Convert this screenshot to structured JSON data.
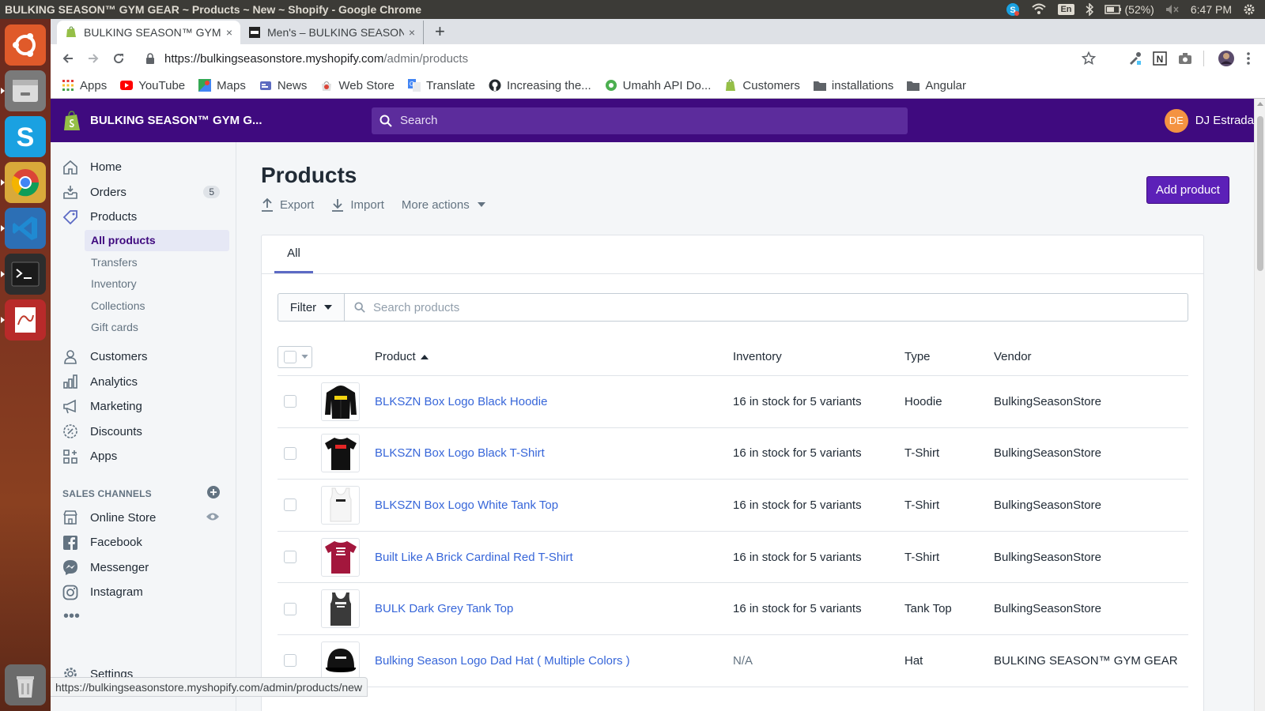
{
  "system": {
    "window_title": "BULKING SEASON™ GYM GEAR ~ Products ~ New ~ Shopify - Google Chrome",
    "lang": "En",
    "battery": "(52%)",
    "time": "6:47 PM"
  },
  "browser": {
    "tabs": [
      {
        "label": "BULKING SEASON™ GYM GEAR ~ Products",
        "close": "×"
      },
      {
        "label": "Men's – BULKING SEASON™ GYM GEAR",
        "close": "×"
      }
    ],
    "new_tab": "+",
    "url_host": "https://bulkingseasonstore.myshopify.com",
    "url_path": "/admin/products",
    "bookmarks": [
      "Apps",
      "YouTube",
      "Maps",
      "News",
      "Web Store",
      "Translate",
      "Increasing the...",
      "Umahh API Do...",
      "Customers",
      "installations",
      "Angular"
    ],
    "status_url": "https://bulkingseasonstore.myshopify.com/admin/products/new"
  },
  "shopify": {
    "store_name": "BULKING SEASON™ GYM G...",
    "search_placeholder": "Search",
    "user_initials": "DE",
    "user_name": "DJ Estrada",
    "nav": {
      "home": "Home",
      "orders": "Orders",
      "orders_badge": "5",
      "products": "Products",
      "sub": [
        "All products",
        "Transfers",
        "Inventory",
        "Collections",
        "Gift cards"
      ],
      "customers": "Customers",
      "analytics": "Analytics",
      "marketing": "Marketing",
      "discounts": "Discounts",
      "apps": "Apps",
      "sales_channels": "SALES CHANNELS",
      "channels": [
        "Online Store",
        "Facebook",
        "Messenger",
        "Instagram"
      ],
      "more": "•••",
      "settings": "Settings"
    },
    "page": {
      "title": "Products",
      "export": "Export",
      "import": "Import",
      "more_actions": "More actions",
      "add_product": "Add product",
      "tab_all": "All",
      "filter": "Filter",
      "search_products": "Search products",
      "columns": {
        "product": "Product",
        "inventory": "Inventory",
        "type": "Type",
        "vendor": "Vendor"
      },
      "rows": [
        {
          "name": "BLKSZN Box Logo Black Hoodie",
          "inventory": "16 in stock for 5 variants",
          "type": "Hoodie",
          "vendor": "BulkingSeasonStore",
          "thumb": "black-hoodie"
        },
        {
          "name": "BLKSZN Box Logo Black T-Shirt",
          "inventory": "16 in stock for 5 variants",
          "type": "T-Shirt",
          "vendor": "BulkingSeasonStore",
          "thumb": "black-tshirt"
        },
        {
          "name": "BLKSZN Box Logo White Tank Top",
          "inventory": "16 in stock for 5 variants",
          "type": "T-Shirt",
          "vendor": "BulkingSeasonStore",
          "thumb": "white-tank"
        },
        {
          "name": "Built Like A Brick Cardinal Red T-Shirt",
          "inventory": "16 in stock for 5 variants",
          "type": "T-Shirt",
          "vendor": "BulkingSeasonStore",
          "thumb": "red-tshirt"
        },
        {
          "name": "BULK Dark Grey Tank Top",
          "inventory": "16 in stock for 5 variants",
          "type": "Tank Top",
          "vendor": "BulkingSeasonStore",
          "thumb": "grey-tank"
        },
        {
          "name": "Bulking Season Logo Dad Hat ( Multiple Colors )",
          "inventory": "N/A",
          "type": "Hat",
          "vendor": "BULKING SEASON™ GYM GEAR",
          "thumb": "black-hat"
        }
      ]
    }
  },
  "colors": {
    "topbar_purple": "#3f0a7f",
    "primary_button": "#5c20b8",
    "link_blue": "#3766d9",
    "ubuntu_bar": "#3c3b37"
  }
}
